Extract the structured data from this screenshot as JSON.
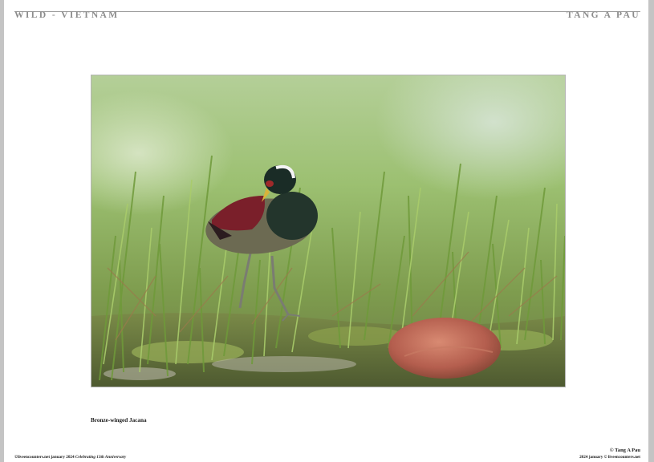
{
  "header": {
    "left_title": "WILD - VIETNAM",
    "right_title": "TANG A PAU"
  },
  "photo": {
    "caption": "Bronze-winged Jacana",
    "subject_icon": "bronze-winged-jacana-photo"
  },
  "footer": {
    "left_main": "©liveencounters.net january 2024 ",
    "left_italic": "Celebrating 13th Anniversary",
    "right_credit": "© Tang A Pau",
    "right_small": "2024 january © liveencounters.net"
  },
  "colors": {
    "page_background": "#ffffff",
    "margin_gray": "#c4c4c4",
    "header_text": "#8c8c8c"
  }
}
